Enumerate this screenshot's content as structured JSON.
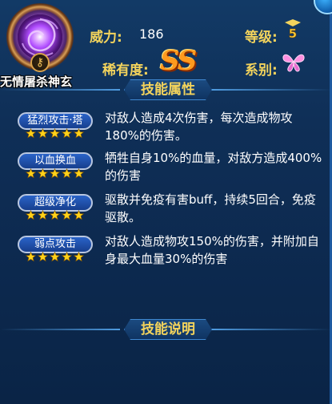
{
  "hero": {
    "name": "无情屠杀神玄",
    "avatar_icon": "purple-energy-orb-icon",
    "badge_icon": "key-icon"
  },
  "stats": {
    "power_label": "威力:",
    "power_value": "186",
    "level_label": "等级:",
    "level_value": "5",
    "rarity_label": "稀有度:",
    "rarity_value": "SS",
    "series_label": "系别:",
    "series_icon": "butterfly-icon"
  },
  "sections": {
    "attributes_title": "技能属性",
    "description_title": "技能说明"
  },
  "skills": [
    {
      "name": "猛烈攻击·塔",
      "stars": 5,
      "desc": "对敌人造成4次伤害，每次造成物攻180%的伤害。"
    },
    {
      "name": "以血换血",
      "stars": 5,
      "desc": "牺牲自身10%的血量，对敌方造成400%的伤害"
    },
    {
      "name": "超级净化",
      "stars": 5,
      "desc": "驱散并免疫有害buff，持续5回合，免疫驱散。"
    },
    {
      "name": "弱点攻击",
      "stars": 5,
      "desc": "对敌人造成物攻150%的伤害，并附加自身最大血量30%的伤害"
    }
  ],
  "colors": {
    "label_gold": "#f3d35c",
    "rarity_orange": "#ff9a1e",
    "star_yellow": "#ffd21a",
    "pill_blue": "#2a63c8"
  }
}
